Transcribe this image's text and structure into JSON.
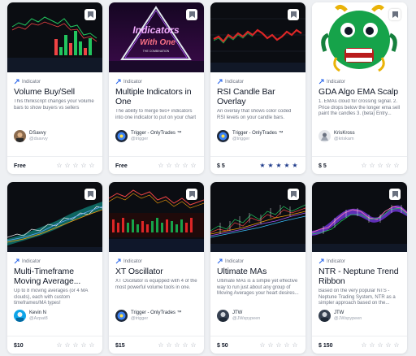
{
  "cards": [
    {
      "category": "Indicator",
      "title": "Volume Buy/Sell",
      "description": "This thinkscript changes your volume bars to show buyers vs sellers",
      "author_name": "DSavvy",
      "author_handle": "@dsavvy",
      "price": "Free",
      "rating": 0,
      "thumb_icon": "green-red-candlestick-chart"
    },
    {
      "category": "Indicator",
      "title": "Multiple Indicators in One",
      "description": "The ability to merge two+ indicators into one indicator to put on your chart",
      "author_name": "Trigger - OnlyTrades ™",
      "author_handle": "@trigger",
      "price": "Free",
      "rating": 0,
      "thumb_icon": "neon-triangle-logo",
      "thumb_text_main": "Indicators",
      "thumb_text_sub": "With One",
      "thumb_text_caption": "THE COMBINATION"
    },
    {
      "category": "Indicator",
      "title": "RSI Candle Bar Overlay",
      "description": "An overlay that shows color coded RSI levels on your candle bars.",
      "author_name": "Trigger - OnlyTrades ™",
      "author_handle": "@trigger",
      "price": "$ 5",
      "rating": 5,
      "thumb_icon": "red-green-candle-overlay-chart"
    },
    {
      "category": "Indicator",
      "title": "GDA Algo EMA Scalp",
      "description": "1. EMAs cloud for crossing signal. 2. Price drops below the longer ema sell paint the candles 3. (beta) Entry...",
      "author_name": "KrisKross",
      "author_handle": "@kriskam",
      "price": "$ 5",
      "rating": 0,
      "thumb_icon": "green-dragon-emoji"
    },
    {
      "category": "Indicator",
      "title": "Multi-Timeframe Moving Average...",
      "description": "Up to 8 moving averages (or 4 MA clouds), each with custom timeframes/MA types!",
      "author_name": "Kevin N",
      "author_handle": "@Azpat8",
      "price": "$10",
      "rating": 0,
      "thumb_icon": "moving-average-cloud-chart"
    },
    {
      "category": "Indicator",
      "title": "XT Oscillator",
      "description": "XT Oscillator is equipped with 4 of the most powerful volume tools in one.",
      "author_name": "Trigger - OnlyTrades ™",
      "author_handle": "@trigger",
      "price": "$15",
      "rating": 0,
      "thumb_icon": "oscillator-histogram-chart"
    },
    {
      "category": "Indicator",
      "title": "Ultimate MAs",
      "description": "Ultimate MAs is a simple yet effective way to run just about any group of Moving Averages your heart desires...",
      "author_name": "JTW",
      "author_handle": "@JWspypeen",
      "price": "$ 50",
      "rating": 0,
      "thumb_icon": "multi-ma-line-chart"
    },
    {
      "category": "Indicator",
      "title": "NTR - Neptune Trend Ribbon",
      "description": "Based on the very popular NTS - Neptune Trading System, NTR as a simpler approach based on the...",
      "author_name": "JTW",
      "author_handle": "@JWspypeen",
      "price": "$ 150",
      "rating": 0,
      "thumb_icon": "trend-ribbon-chart"
    }
  ],
  "colors": {
    "star_filled": "#1e3a8a",
    "star_empty": "#9ca3af",
    "category_icon": "#2563eb"
  },
  "icons": {
    "bookmark": "bookmark-icon",
    "category": "indicator-icon",
    "star": "star-icon"
  }
}
